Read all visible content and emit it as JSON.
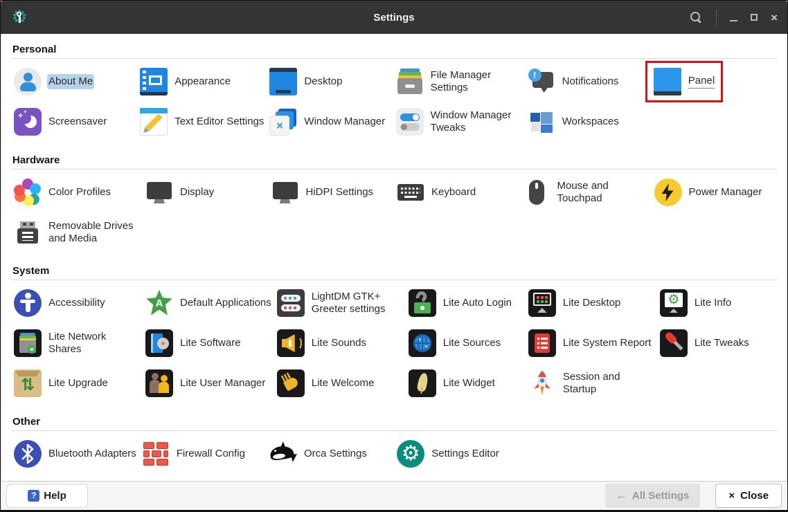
{
  "window": {
    "title": "Settings"
  },
  "titlebar": {
    "buttons": [
      "search",
      "minimize",
      "maximize",
      "close"
    ]
  },
  "icons": {
    "gear_glyph": "⚙",
    "exclamation_glyph": "!",
    "x_glyph": "×",
    "letter_a_glyph": "A",
    "up_down_arrows_glyph": "⇅",
    "sparkle_glyph": "+",
    "help_glyph": "?",
    "back_arrow_glyph": "←",
    "close_glyph": "×",
    "titlebar_close_glyph": "×"
  },
  "theme": {
    "titlebar_bg": "#343434",
    "accent_blue": "#2e96ea",
    "selection_highlight": "#b6d3ec",
    "annotation_red": "#dc1010",
    "footer_bg": "#f5f5f5"
  },
  "annotation": {
    "shape": "rectangle",
    "color": "#dc1010",
    "target_item": "Panel"
  },
  "sections": [
    {
      "label": "Personal",
      "items": [
        {
          "label": "About Me",
          "icon": "about-me",
          "selected": true
        },
        {
          "label": "Appearance",
          "icon": "appearance"
        },
        {
          "label": "Desktop",
          "icon": "desktop"
        },
        {
          "label": "File Manager Settings",
          "icon": "file-manager"
        },
        {
          "label": "Notifications",
          "icon": "notifications"
        },
        {
          "label": "Panel",
          "icon": "panel",
          "annotated": true,
          "focused": true
        },
        {
          "label": "Screensaver",
          "icon": "screensaver"
        },
        {
          "label": "Text Editor Settings",
          "icon": "text-editor"
        },
        {
          "label": "Window Manager",
          "icon": "window-manager"
        },
        {
          "label": "Window Manager Tweaks",
          "icon": "wm-tweaks"
        },
        {
          "label": "Workspaces",
          "icon": "workspaces"
        }
      ]
    },
    {
      "label": "Hardware",
      "items": [
        {
          "label": "Color Profiles",
          "icon": "color-profiles"
        },
        {
          "label": "Display",
          "icon": "display"
        },
        {
          "label": "HiDPI Settings",
          "icon": "hidpi"
        },
        {
          "label": "Keyboard",
          "icon": "keyboard"
        },
        {
          "label": "Mouse and Touchpad",
          "icon": "mouse"
        },
        {
          "label": "Power Manager",
          "icon": "power"
        },
        {
          "label": "Removable Drives and Media",
          "icon": "usb"
        }
      ]
    },
    {
      "label": "System",
      "items": [
        {
          "label": "Accessibility",
          "icon": "accessibility"
        },
        {
          "label": "Default Applications",
          "icon": "default-apps"
        },
        {
          "label": "LightDM GTK+ Greeter settings",
          "icon": "lightdm"
        },
        {
          "label": "Lite Auto Login",
          "icon": "auto-login"
        },
        {
          "label": "Lite Desktop",
          "icon": "lite-desktop"
        },
        {
          "label": "Lite Info",
          "icon": "lite-info"
        },
        {
          "label": "Lite Network Shares",
          "icon": "network-shares"
        },
        {
          "label": "Lite Software",
          "icon": "lite-software"
        },
        {
          "label": "Lite Sounds",
          "icon": "lite-sounds"
        },
        {
          "label": "Lite Sources",
          "icon": "lite-sources"
        },
        {
          "label": "Lite System Report",
          "icon": "sys-report"
        },
        {
          "label": "Lite Tweaks",
          "icon": "lite-tweaks"
        },
        {
          "label": "Lite Upgrade",
          "icon": "lite-upgrade"
        },
        {
          "label": "Lite User Manager",
          "icon": "user-manager"
        },
        {
          "label": "Lite Welcome",
          "icon": "lite-welcome"
        },
        {
          "label": "Lite Widget",
          "icon": "lite-widget"
        },
        {
          "label": "Session and Startup",
          "icon": "rocket"
        }
      ]
    },
    {
      "label": "Other",
      "items": [
        {
          "label": "Bluetooth Adapters",
          "icon": "bluetooth"
        },
        {
          "label": "Firewall Config",
          "icon": "firewall"
        },
        {
          "label": "Orca Settings",
          "icon": "orca"
        },
        {
          "label": "Settings Editor",
          "icon": "settings-editor"
        }
      ]
    }
  ],
  "footer": {
    "help_label": "Help",
    "all_settings_label": "All Settings",
    "close_label": "Close",
    "all_settings_enabled": false
  }
}
